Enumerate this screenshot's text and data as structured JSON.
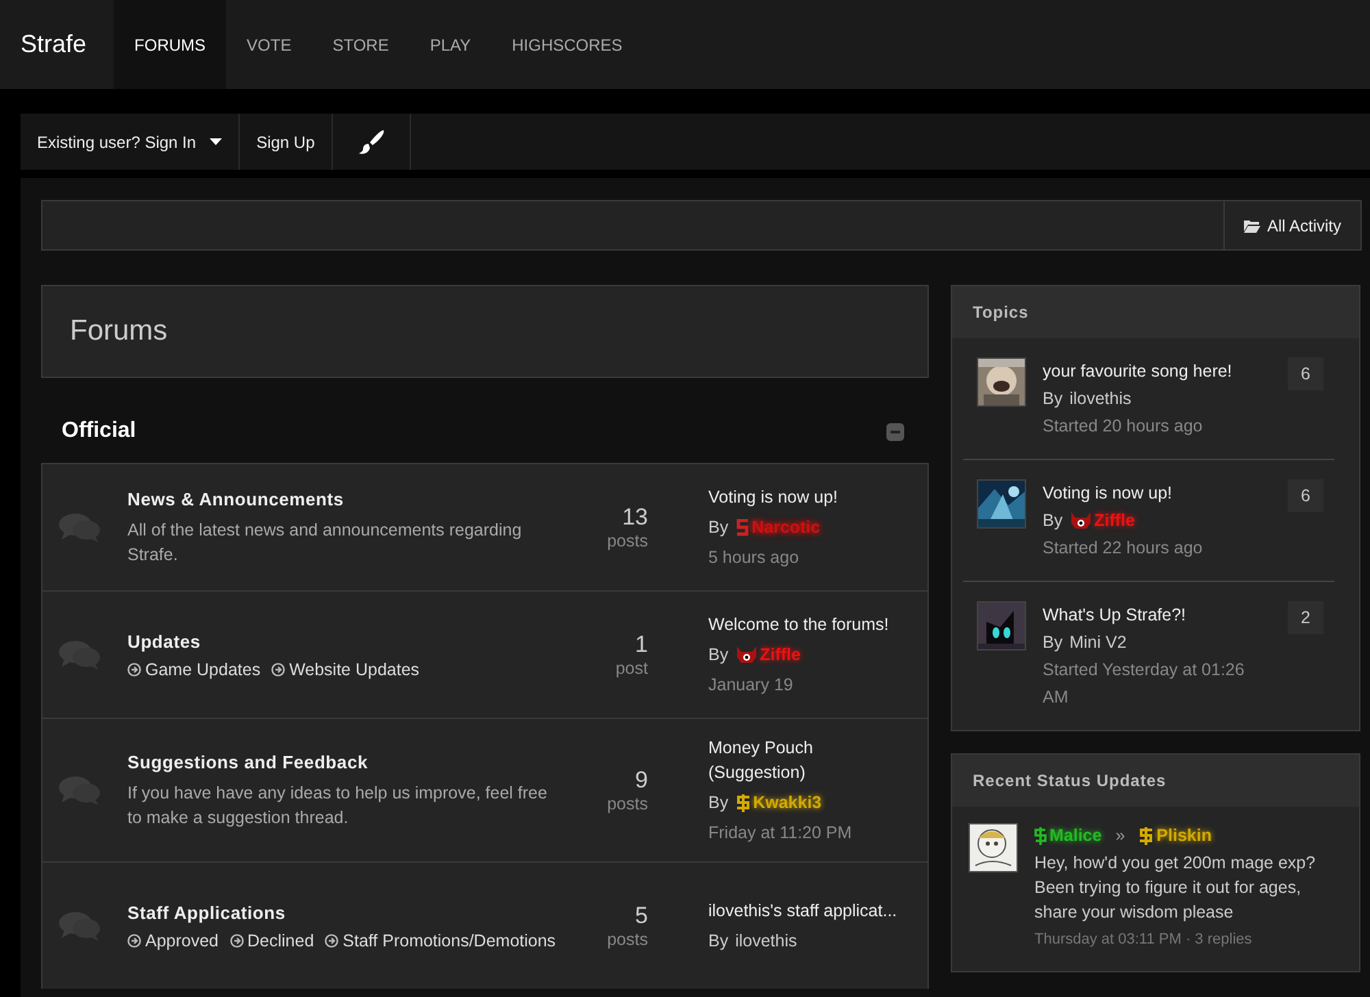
{
  "site": {
    "title": "Strafe"
  },
  "nav": [
    {
      "label": "FORUMS",
      "selected": true
    },
    {
      "label": "VOTE",
      "selected": false
    },
    {
      "label": "STORE",
      "selected": false
    },
    {
      "label": "PLAY",
      "selected": false
    },
    {
      "label": "HIGHSCORES",
      "selected": false
    }
  ],
  "user_bar": {
    "sign_in": "Existing user? Sign In",
    "sign_up": "Sign Up"
  },
  "breadcrumb": {
    "all_activity": "All Activity"
  },
  "page_title": "Forums",
  "category": {
    "title": "Official",
    "expanded": true
  },
  "forums": [
    {
      "title": "News & Announcements",
      "description": "All of the latest news and announcements regarding Strafe.",
      "count": "13",
      "count_label": "posts",
      "last_title": "Voting is now up!",
      "by": "By",
      "user": {
        "name": "Narcotic",
        "color": "#cc1111",
        "kind": "staff",
        "blurred": true
      },
      "time": "5 hours ago"
    },
    {
      "title": "Updates",
      "subforums": [
        "Game Updates",
        "Website Updates"
      ],
      "count": "1",
      "count_label": "post",
      "last_title": "Welcome to the forums!",
      "by": "By",
      "user": {
        "name": "Ziffle",
        "color": "#ee1111",
        "kind": "demon",
        "blurred": false
      },
      "time": "January 19"
    },
    {
      "title": "Suggestions and Feedback",
      "description": "If you have have any ideas to help us improve, feel free to make a suggestion thread.",
      "count": "9",
      "count_label": "posts",
      "last_title": "Money Pouch (Suggestion)",
      "by": "By",
      "user": {
        "name": "Kwakki3",
        "color": "#d4aa00",
        "kind": "money",
        "blurred": false
      },
      "time": "Friday at 11:20 PM"
    },
    {
      "title": "Staff Applications",
      "subforums": [
        "Approved",
        "Declined",
        "Staff Promotions/Demotions"
      ],
      "count": "5",
      "count_label": "posts",
      "last_title": "ilovethis's staff applicat...",
      "by": "By",
      "user": {
        "name": "ilovethis",
        "color": "#cccccc",
        "kind": "none",
        "blurred": false
      }
    }
  ],
  "topics": {
    "title": "Topics",
    "items": [
      {
        "title": "your favourite song here!",
        "by": "By",
        "user": {
          "name": "ilovethis",
          "color": "#cccccc",
          "kind": "none"
        },
        "started": "Started 20 hours ago",
        "count": "6"
      },
      {
        "title": "Voting is now up!",
        "by": "By",
        "user": {
          "name": "Ziffle",
          "color": "#ee1111",
          "kind": "demon"
        },
        "started": "Started 22 hours ago",
        "count": "6"
      },
      {
        "title": "What's Up Strafe?!",
        "by": "By",
        "user": {
          "name": "Mini V2",
          "color": "#cccccc",
          "kind": "none"
        },
        "started": "Started Yesterday at 01:26 AM",
        "count": "2"
      }
    ]
  },
  "status_updates": {
    "title": "Recent Status Updates",
    "items": [
      {
        "from": {
          "name": "Malice",
          "color": "#22bb22",
          "kind": "money_green"
        },
        "separator": "»",
        "to": {
          "name": "Pliskin",
          "color": "#d4aa00",
          "kind": "money"
        },
        "text": "Hey, how'd you get 200m mage exp? Been trying to figure it out for ages, share your wisdom please",
        "meta": "Thursday at 03:11 PM · 3 replies"
      }
    ]
  }
}
